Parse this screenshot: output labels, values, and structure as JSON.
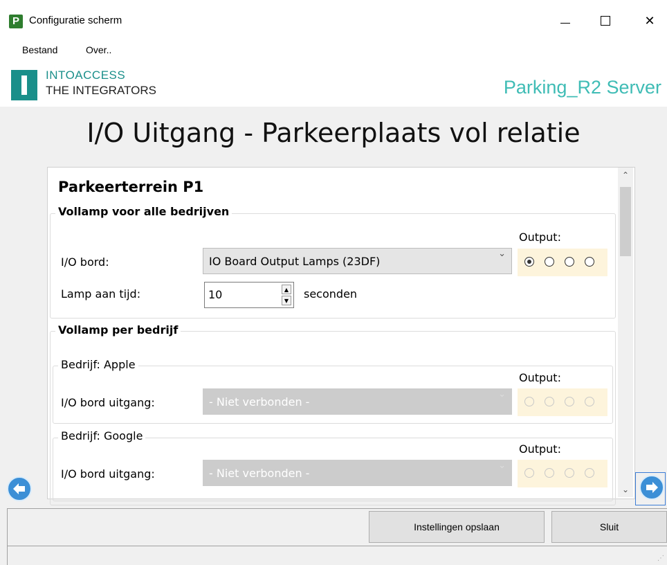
{
  "window": {
    "title": "Configuratie scherm",
    "app_icon_letter": "P"
  },
  "menu": {
    "items": [
      "Bestand",
      "Over.."
    ]
  },
  "header": {
    "logo_top": "INTOACCESS",
    "logo_bottom": "THE INTEGRATORS",
    "server_name": "Parking_R2 Server"
  },
  "page_title": "I/O Uitgang - Parkeerplaats vol relatie",
  "panel": {
    "section_title": "Parkeerterrein P1",
    "all_companies": {
      "legend": "Vollamp voor alle bedrijven",
      "output_label": "Output:",
      "io_board_label": "I/O bord:",
      "io_board_value": "IO Board Output Lamps (23DF)",
      "lamp_time_label": "Lamp aan tijd:",
      "lamp_time_value": "10",
      "lamp_time_unit": "seconden",
      "selected_output": 1
    },
    "per_company": {
      "legend": "Vollamp per bedrijf",
      "companies": [
        {
          "legend": "Bedrijf: Apple",
          "output_label": "Output:",
          "io_label": "I/O bord uitgang:",
          "io_value": "- Niet verbonden -"
        },
        {
          "legend": "Bedrijf: Google",
          "output_label": "Output:",
          "io_label": "I/O bord uitgang:",
          "io_value": "- Niet verbonden -"
        }
      ]
    }
  },
  "footer": {
    "save_label": "Instellingen opslaan",
    "close_label": "Sluit"
  },
  "colors": {
    "accent_teal": "#1a8f8a",
    "server_teal": "#3fbcb5",
    "output_bg": "#fdf4dc",
    "nav_blue": "#3c8fd6"
  },
  "icons": [
    "app-icon",
    "minimize-icon",
    "maximize-icon",
    "close-icon",
    "chevron-down-icon",
    "arrow-left-icon",
    "arrow-right-icon",
    "scroll-up-icon",
    "scroll-down-icon"
  ]
}
